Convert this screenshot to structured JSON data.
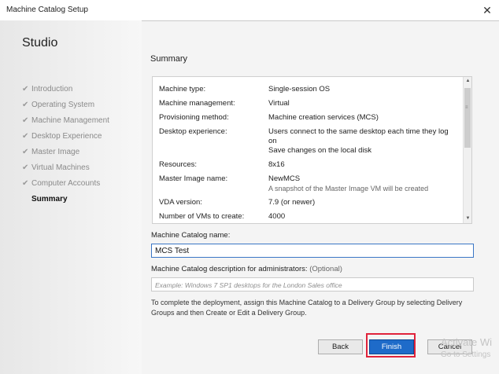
{
  "window": {
    "title": "Machine Catalog Setup",
    "close_glyph": "✕"
  },
  "sidebar": {
    "brand": "Studio",
    "steps": [
      {
        "label": "Introduction",
        "done": true
      },
      {
        "label": "Operating System",
        "done": true
      },
      {
        "label": "Machine Management",
        "done": true
      },
      {
        "label": "Desktop Experience",
        "done": true
      },
      {
        "label": "Master Image",
        "done": true
      },
      {
        "label": "Virtual Machines",
        "done": true
      },
      {
        "label": "Computer Accounts",
        "done": true
      },
      {
        "label": "Summary",
        "done": false,
        "current": true
      }
    ]
  },
  "main": {
    "heading": "Summary",
    "summary": [
      {
        "label": "Machine type:",
        "value": "Single-session OS"
      },
      {
        "label": "Machine management:",
        "value": "Virtual"
      },
      {
        "label": "Provisioning method:",
        "value": "Machine creation services (MCS)"
      },
      {
        "label": "Desktop experience:",
        "value": "Users connect to the same desktop each time they log on",
        "value2": "Save changes on the local disk"
      },
      {
        "label": "Resources:",
        "value": "8x16"
      },
      {
        "label": "Master Image name:",
        "value": "NewMCS",
        "note": "A snapshot of the Master Image VM will be created"
      },
      {
        "label": "VDA version:",
        "value": "7.9 (or newer)"
      },
      {
        "label": "Number of VMs to create:",
        "value": "4000"
      }
    ],
    "catalog_name_label": "Machine Catalog name:",
    "catalog_name_value": "MCS Test",
    "description_label": "Machine Catalog description for administrators:",
    "description_optional": "(Optional)",
    "description_placeholder": "Example: Windows 7 SP1 desktops for the London Sales office",
    "info_text": "To complete the deployment, assign this Machine Catalog to a Delivery Group by selecting Delivery Groups and then Create or Edit a Delivery Group."
  },
  "buttons": {
    "back": "Back",
    "finish": "Finish",
    "cancel": "Cancel"
  },
  "watermark": {
    "line1": "Activate Wi",
    "line2": "Go to Settings"
  },
  "colors": {
    "accent": "#1e6bc9",
    "highlight": "#e0233b"
  }
}
